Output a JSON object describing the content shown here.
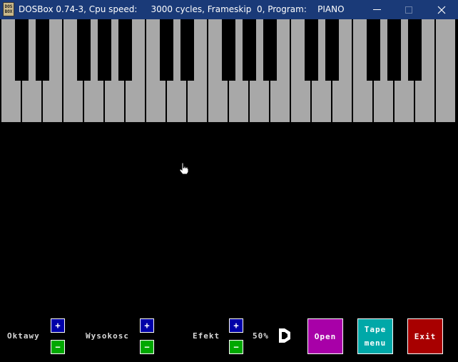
{
  "window": {
    "app_icon_text": "DOS BOX",
    "title": "DOSBox 0.74-3, Cpu speed:     3000 cycles, Frameskip  0, Program:    PIANO"
  },
  "controls": {
    "octaves_label": "Oktawy",
    "pitch_label": "Wysokosc",
    "effect_label": "Efekt",
    "plus": "+",
    "minus": "−",
    "effect_value": "50%",
    "open_label": "Open",
    "tape_label_1": "Tape",
    "tape_label_2": "menu",
    "exit_label": "Exit"
  },
  "colors": {
    "white_key": "#a8a8a8",
    "black_key": "#000000",
    "plus_button": "#0000a8",
    "minus_button": "#00a800",
    "open_button": "#a800a8",
    "tape_button": "#00a8a8",
    "exit_button": "#a80000"
  },
  "icons": [
    "dosbox-app-icon",
    "minimize-icon",
    "maximize-icon",
    "close-icon",
    "hand-cursor-icon",
    "speaker-icon"
  ]
}
